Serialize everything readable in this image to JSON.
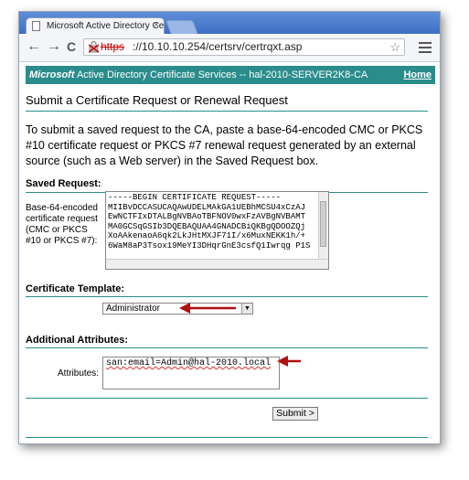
{
  "browser": {
    "tab_title": "Microsoft Active Directory Ce",
    "tab_close": "×",
    "url_protocol": "https",
    "url_rest": "://10.10.10.254/certsrv/certrqxt.asp",
    "back_icon": "←",
    "forward_icon": "→",
    "reload_icon": "C",
    "star_icon": "☆"
  },
  "header": {
    "brand": "Microsoft",
    "service": "Active Directory Certificate Services  --  hal-2010-SERVER2K8-CA",
    "home_label": "Home",
    "bg_color": "#2b8c8c"
  },
  "page": {
    "title": "Submit a Certificate Request or Renewal Request",
    "intro": "To submit a saved request to the CA, paste a base-64-encoded CMC or PKCS #10 certificate request or PKCS #7 renewal request generated by an external source (such as a Web server) in the Saved Request box."
  },
  "saved_request": {
    "section_label": "Saved Request:",
    "field_label": "Base-64-encoded certificate request (CMC or PKCS #10 or PKCS #7):",
    "lines": [
      "-----BEGIN CERTIFICATE REQUEST-----",
      "MIIBvDCCASUCAQAwUDELMAkGA1UEBhMCSU4xCzAJ",
      "EwNCTFIxDTALBgNVBAoTBFNOV0wxFzAVBgNVBAMT",
      "MA0GCSqGSIb3DQEBAQUAA4GNADCBiQKBgQDOOZQj",
      "XoAAkenaoA6qk2LkJHtMXJF71I/x6MuxNEKK1h/+",
      "6WaM8aP3Tsox19MeYI3DHqrGnE3csfQ1Iwrqg P1S"
    ]
  },
  "template": {
    "section_label": "Certificate Template:",
    "selected": "Administrator"
  },
  "attributes": {
    "section_label": "Additional Attributes:",
    "field_label": "Attributes:",
    "value": "san:email=Admin@hal-2010.local"
  },
  "submit_label": "Submit >",
  "annotation_color": "#b01010"
}
